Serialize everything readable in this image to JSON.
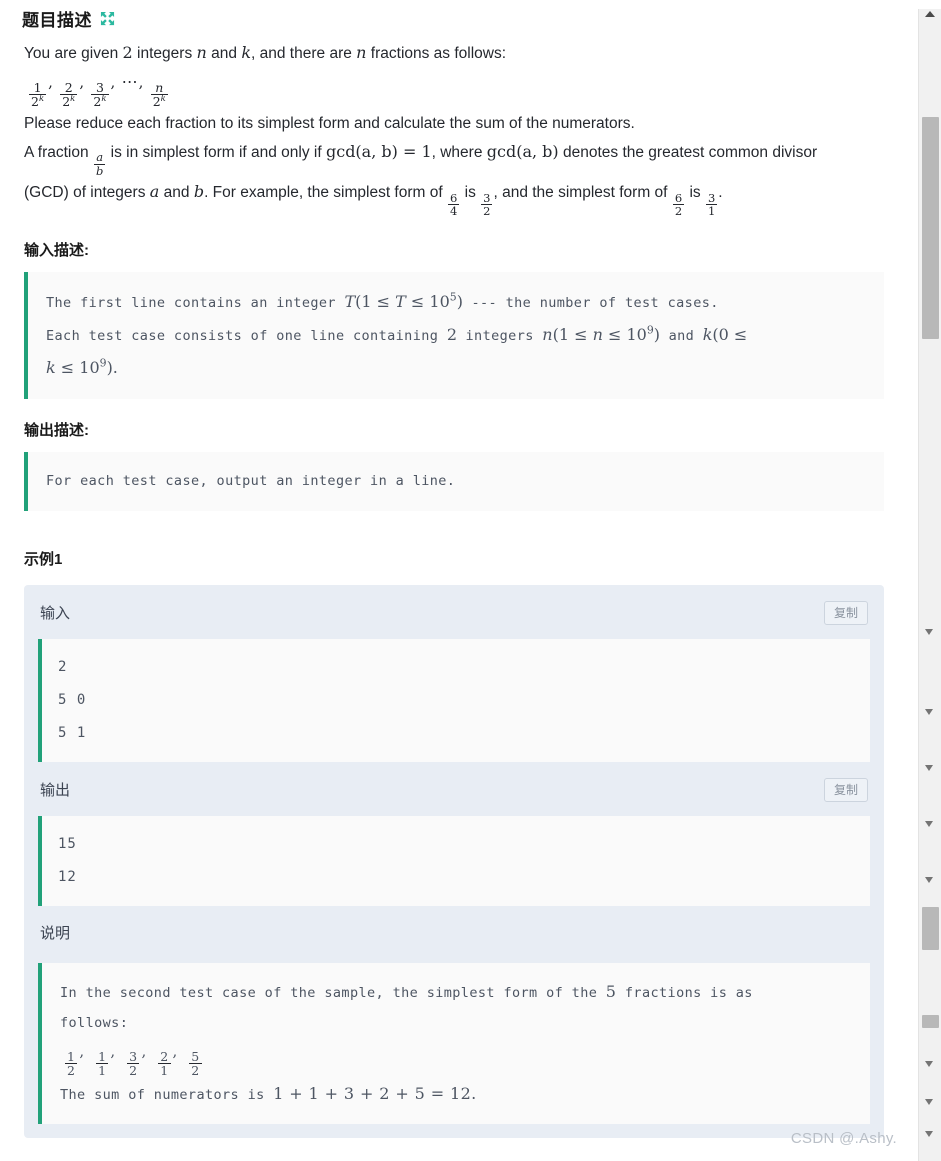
{
  "header": {
    "title": "题目描述",
    "expand_icon": "expand-arrows-icon",
    "accent_color": "#2cb9a0"
  },
  "description": {
    "line1_a": "You are given",
    "line1_n1": "2",
    "line1_b": "integers",
    "line1_n": "n",
    "line1_c": "and",
    "line1_k": "k",
    "line1_d": ", and there are",
    "line1_n2": "n",
    "line1_e": "fractions as follows:",
    "fractions": [
      "1/2^k",
      "2/2^k",
      "3/2^k",
      "⋯",
      "n/2^k"
    ],
    "line3": "Please reduce each fraction to its simplest form and calculate the sum of the numerators.",
    "line4_a": "A fraction",
    "line4_frac": "a/b",
    "line4_b": "is in simplest form if and only if",
    "line4_gcd": "gcd(a, b) = 1",
    "line4_c": ", where",
    "line4_gcd2": "gcd(a, b)",
    "line4_d": "denotes the greatest common divisor",
    "line5_a": "(GCD) of integers",
    "line5_a_var": "a",
    "line5_b": "and",
    "line5_b_var": "b",
    "line5_c": ". For example, the simplest form of",
    "line5_f1": "6/4",
    "line5_d": "is",
    "line5_f2": "3/2",
    "line5_e": ", and the simplest form of",
    "line5_f3": "6/2",
    "line5_f": "is",
    "line5_f4": "3/1",
    "line5_g": "."
  },
  "input_section": {
    "heading": "输入描述:",
    "line1_a": "The first line contains an integer",
    "line1_math": "T(1 ≤ T ≤ 10^5)",
    "line1_b": "--- the number of test cases.",
    "line2_a": "Each test case consists of one line containing",
    "line2_n": "2",
    "line2_b": "integers",
    "line2_math1": "n(1 ≤ n ≤ 10^9)",
    "line2_c": "and",
    "line2_math2": "k(0 ≤",
    "line3_math": "k ≤ 10^9)."
  },
  "output_section": {
    "heading": "输出描述:",
    "text": "For each test case, output an integer in a line."
  },
  "example": {
    "heading": "示例1",
    "input_label": "输入",
    "input_copy_label": "复制",
    "input_lines": [
      "2",
      "5 0",
      "5 1"
    ],
    "output_label": "输出",
    "output_copy_label": "复制",
    "output_lines": [
      "15",
      "12"
    ],
    "note_label": "说明",
    "note_line1_a": "In the second test case of the sample, the simplest form of the",
    "note_line1_n": "5",
    "note_line1_b": "fractions is as",
    "note_line2": "follows:",
    "note_fractions": [
      "1/2",
      "1/1",
      "3/2",
      "2/1",
      "5/2"
    ],
    "note_line4_a": "The sum of numerators is",
    "note_line4_math": "1 + 1 + 3 + 2 + 5 = 12",
    "note_line4_b": "."
  },
  "watermark": "CSDN @.Ashy."
}
